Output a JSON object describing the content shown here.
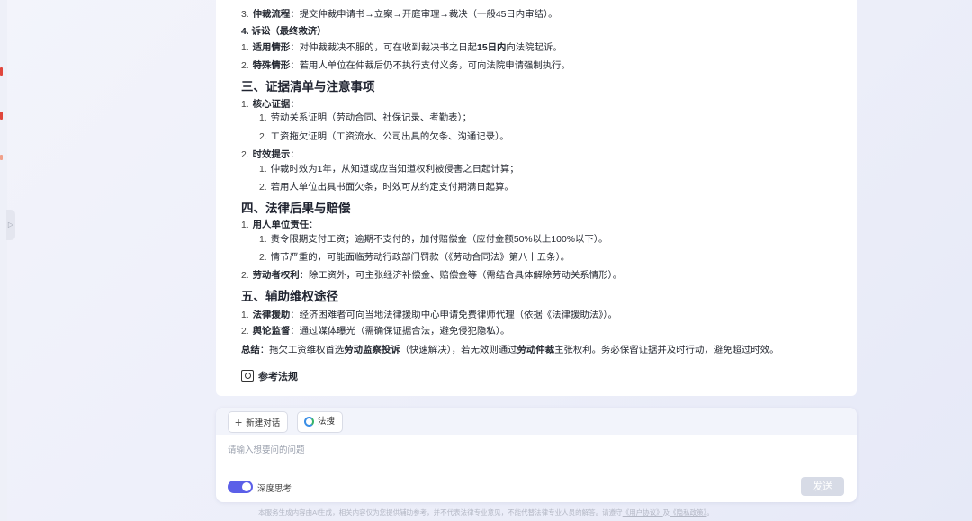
{
  "content": {
    "lines": [
      {
        "type": "l2",
        "num": "3.",
        "bold": "仲裁流程",
        "rest": "：提交仲裁申请书→立案→开庭审理→裁决（一般45日内审结）。"
      },
      {
        "type": "sub",
        "text": "4. 诉讼（最终救济）"
      },
      {
        "type": "l2",
        "num": "1.",
        "bold": "适用情形",
        "rest": "：对仲裁裁决不服的，可在收到裁决书之日起",
        "bold2": "15日内",
        "rest2": "向法院起诉。"
      },
      {
        "type": "l2",
        "num": "2.",
        "bold": "特殊情形",
        "rest": "：若用人单位在仲裁后仍不执行支付义务，可向法院申请强制执行。"
      },
      {
        "type": "heading",
        "text": "三、证据清单与注意事项"
      },
      {
        "type": "l2",
        "num": "1.",
        "bold": "核心证据",
        "rest": "："
      },
      {
        "type": "l3",
        "num": "1.",
        "rest": "劳动关系证明（劳动合同、社保记录、考勤表）；"
      },
      {
        "type": "l3",
        "num": "2.",
        "rest": "工资拖欠证明（工资流水、公司出具的欠条、沟通记录）。"
      },
      {
        "type": "l2",
        "num": "2.",
        "bold": "时效提示",
        "rest": "："
      },
      {
        "type": "l3",
        "num": "1.",
        "rest": "仲裁时效为1年，从知道或应当知道权利被侵害之日起计算；"
      },
      {
        "type": "l3",
        "num": "2.",
        "rest": "若用人单位出具书面欠条，时效可从约定支付期满日起算。"
      },
      {
        "type": "heading",
        "text": "四、法律后果与赔偿"
      },
      {
        "type": "l2",
        "num": "1.",
        "bold": "用人单位责任",
        "rest": "："
      },
      {
        "type": "l3",
        "num": "1.",
        "rest": "责令限期支付工资；逾期不支付的，加付赔偿金（应付金额50%以上100%以下）。"
      },
      {
        "type": "l3",
        "num": "2.",
        "rest": "情节严重的，可能面临劳动行政部门罚款（《劳动合同法》第八十五条）。"
      },
      {
        "type": "l2",
        "num": "2.",
        "bold": "劳动者权利",
        "rest": "：除工资外，可主张经济补偿金、赔偿金等（需结合具体解除劳动关系情形）。"
      },
      {
        "type": "heading",
        "text": "五、辅助维权途径"
      },
      {
        "type": "l2",
        "num": "1.",
        "bold": "法律援助",
        "rest": "：经济困难者可向当地法律援助中心申请免费律师代理（依据《法律援助法》）。"
      },
      {
        "type": "l2",
        "num": "2.",
        "bold": "舆论监督",
        "rest": "：通过媒体曝光（需确保证据合法，避免侵犯隐私）。"
      }
    ],
    "summary": {
      "label": "总结",
      "p1": "：拖欠工资维权首选",
      "b1": "劳动监察投诉",
      "p2": "（快速解决），若无效则通过",
      "b2": "劳动仲裁",
      "p3": "主张权利。务必保留证据并及时行动，避免超过时效。"
    },
    "reference_label": "参考法规"
  },
  "composer": {
    "new_chat_label": "新建对话",
    "law_search_label": "法搜",
    "input_placeholder": "请输入想要问的问题",
    "deep_think_label": "深度思考",
    "deep_think_on": true,
    "send_label": "发送"
  },
  "footer": {
    "text": "本服务生成内容由AI生成，相关内容仅为您提供辅助参考，并不代表法律专业意见，不能代替法律专业人员的解答。请遵守",
    "link1": "《用户协议》",
    "sep": "及",
    "link2": "《隐私政策》",
    "end": "。"
  },
  "colors": {
    "accent": "#5b5fe8",
    "send_disabled": "#d7dbe6"
  }
}
